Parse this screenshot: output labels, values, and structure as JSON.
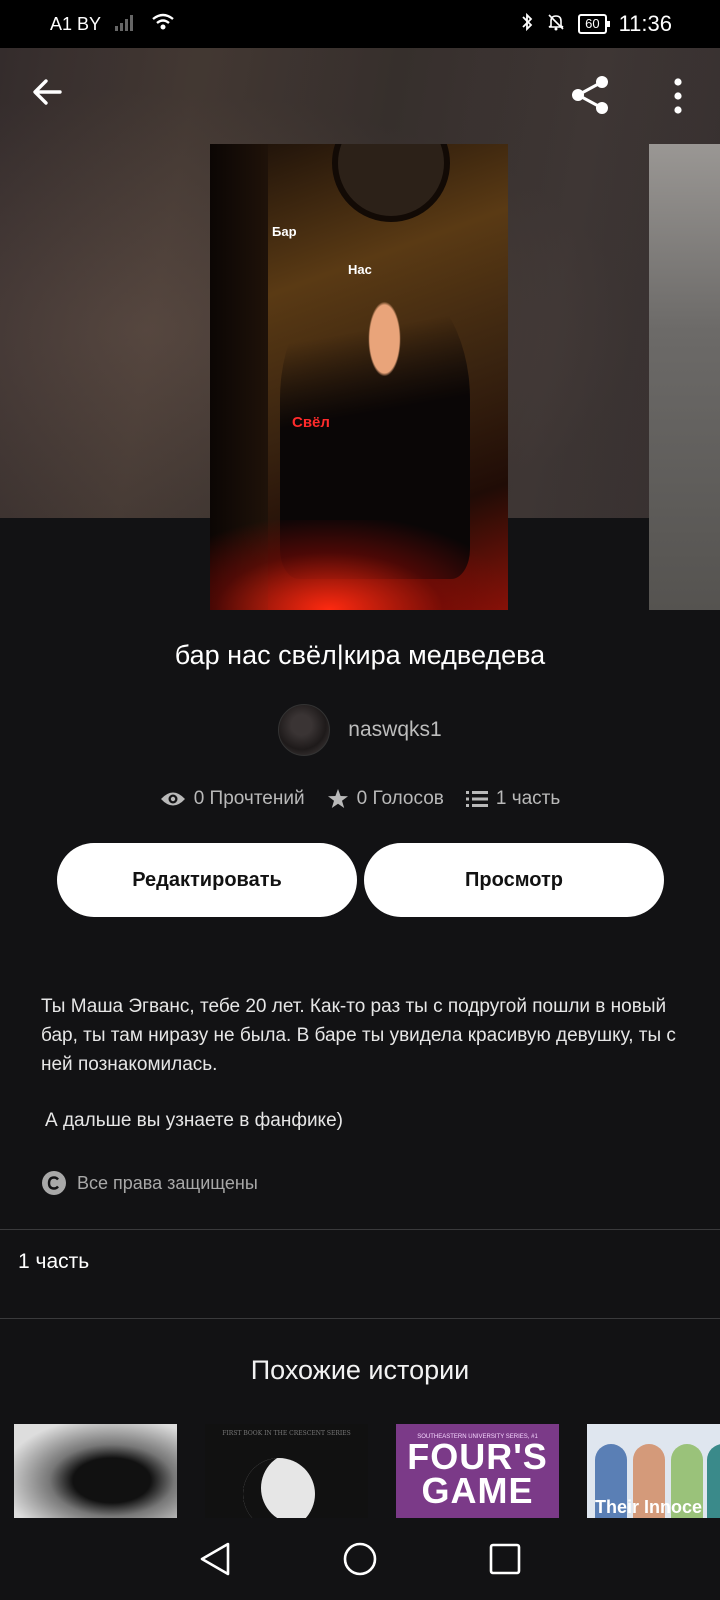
{
  "status_bar": {
    "carrier": "A1 BY",
    "battery": "60",
    "time": "11:36"
  },
  "cover": {
    "words": [
      "Бар",
      "Нас",
      "Свёл"
    ]
  },
  "story": {
    "title": "бар нас свёл|кира медведева",
    "author": "naswqks1",
    "reads": "0 Прочтений",
    "votes": "0 Голосов",
    "parts": "1 часть"
  },
  "buttons": {
    "edit": "Редактировать",
    "view": "Просмотр"
  },
  "description": {
    "text": "Ты Маша Эгванс, тебе 20 лет. Как-то раз ты с подругой пошли в новый бар, ты там ниразу не была. В баре ты увидела красивую девушку, ты с ней познакомилась.",
    "continuation": "А дальше вы узнаете в фанфике)",
    "rights": "Все права защищены"
  },
  "parts_list": {
    "item": "1 часть"
  },
  "similar": {
    "title": "Похожие истории",
    "books": [
      {
        "caption": ""
      },
      {
        "caption": "FIRST BOOK IN THE CRESCENT SERIES"
      },
      {
        "caption_small": "SOUTHEASTERN UNIVERSITY SERIES, #1",
        "caption_big": "FOUR'S GAME"
      },
      {
        "caption": "Their Innoce"
      }
    ]
  },
  "icons": {
    "back": "arrow-left-icon",
    "share": "share-icon",
    "more": "more-vertical-icon",
    "reads": "eye-icon",
    "votes": "star-icon",
    "parts": "list-icon",
    "rights": "copyright-icon"
  }
}
